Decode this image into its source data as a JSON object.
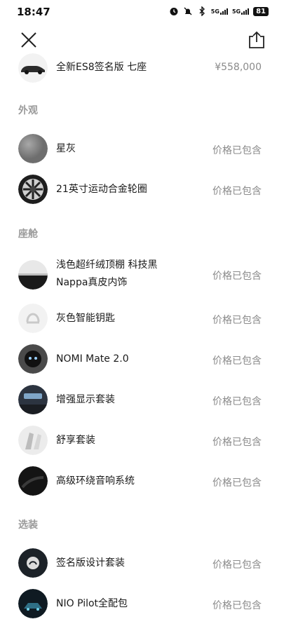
{
  "status_bar": {
    "time": "18:47",
    "signal1": "5G",
    "signal2": "5G",
    "battery": "81"
  },
  "nav": {
    "close_icon": "close-icon",
    "share_icon": "share-icon"
  },
  "header_item": {
    "name": "全新ES8签名版 七座",
    "price": "¥558,000"
  },
  "sections": {
    "exterior": "外观",
    "cabin": "座舱",
    "options": "选装"
  },
  "items": {
    "star_gray": {
      "name": "星灰",
      "price": "价格已包含"
    },
    "wheels": {
      "name": "21英寸运动合金轮圈",
      "price": "价格已包含"
    },
    "interior": {
      "name_line1": "浅色超纤绒顶棚 科技黑",
      "name_line2": "Nappa真皮内饰",
      "price": "价格已包含"
    },
    "key": {
      "name": "灰色智能钥匙",
      "price": "价格已包含"
    },
    "nomi": {
      "name": "NOMI Mate 2.0",
      "price": "价格已包含"
    },
    "hud": {
      "name": "增强显示套装",
      "price": "价格已包含"
    },
    "comfort": {
      "name": "舒享套装",
      "price": "价格已包含"
    },
    "audio": {
      "name": "高级环绕音响系统",
      "price": "价格已包含"
    },
    "signature": {
      "name": "签名版设计套装",
      "price": "价格已包含"
    },
    "pilot": {
      "name": "NIO Pilot全配包",
      "price": "价格已包含"
    }
  }
}
